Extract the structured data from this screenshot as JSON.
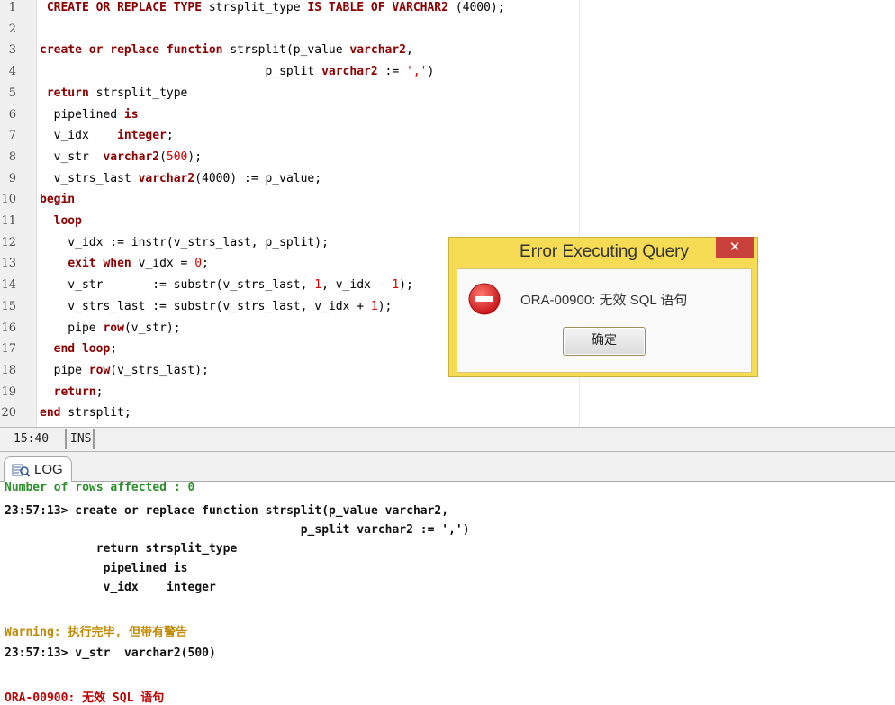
{
  "editor": {
    "line_numbers": [
      "1",
      "2",
      "3",
      "4",
      "5",
      "6",
      "7",
      "8",
      "9",
      "10",
      "11",
      "12",
      "13",
      "14",
      "15",
      "16",
      "17",
      "18",
      "19",
      "20"
    ],
    "lines": [
      [
        {
          "t": " ",
          "c": ""
        },
        {
          "t": "CREATE OR REPLACE TYPE",
          "c": "kw"
        },
        {
          "t": " strsplit_type ",
          "c": ""
        },
        {
          "t": "IS TABLE OF VARCHAR2",
          "c": "kw"
        },
        {
          "t": " (4000);",
          "c": ""
        }
      ],
      [],
      [
        {
          "t": "create or replace function",
          "c": "kw"
        },
        {
          "t": " strsplit(p_value ",
          "c": ""
        },
        {
          "t": "varchar2",
          "c": "kw"
        },
        {
          "t": ",",
          "c": ""
        }
      ],
      [
        {
          "t": "                                p_split ",
          "c": ""
        },
        {
          "t": "varchar2",
          "c": "kw"
        },
        {
          "t": " := ",
          "c": ""
        },
        {
          "t": "','",
          "c": "str"
        },
        {
          "t": ")",
          "c": ""
        }
      ],
      [
        {
          "t": " return",
          "c": "kw"
        },
        {
          "t": " strsplit_type",
          "c": ""
        }
      ],
      [
        {
          "t": "  pipelined ",
          "c": ""
        },
        {
          "t": "is",
          "c": "kw"
        }
      ],
      [
        {
          "t": "  v_idx    ",
          "c": ""
        },
        {
          "t": "integer",
          "c": "kw"
        },
        {
          "t": ";",
          "c": ""
        }
      ],
      [
        {
          "t": "  v_str  ",
          "c": ""
        },
        {
          "t": "varchar2",
          "c": "kw"
        },
        {
          "t": "(",
          "c": ""
        },
        {
          "t": "500",
          "c": "num"
        },
        {
          "t": ");",
          "c": ""
        }
      ],
      [
        {
          "t": "  v_strs_last ",
          "c": ""
        },
        {
          "t": "varchar2",
          "c": "kw"
        },
        {
          "t": "(4000) := p_value;",
          "c": ""
        }
      ],
      [
        {
          "t": "begin",
          "c": "kw"
        }
      ],
      [
        {
          "t": "  loop",
          "c": "kw"
        }
      ],
      [
        {
          "t": "    v_idx := instr(v_strs_last, p_split);",
          "c": ""
        }
      ],
      [
        {
          "t": "    ",
          "c": ""
        },
        {
          "t": "exit when",
          "c": "kw"
        },
        {
          "t": " v_idx = ",
          "c": ""
        },
        {
          "t": "0",
          "c": "num"
        },
        {
          "t": ";",
          "c": ""
        }
      ],
      [
        {
          "t": "    v_str       := substr(v_strs_last, ",
          "c": ""
        },
        {
          "t": "1",
          "c": "num"
        },
        {
          "t": ", v_idx - ",
          "c": ""
        },
        {
          "t": "1",
          "c": "num"
        },
        {
          "t": ");",
          "c": ""
        }
      ],
      [
        {
          "t": "    v_strs_last := substr(v_strs_last, v_idx + ",
          "c": ""
        },
        {
          "t": "1",
          "c": "num"
        },
        {
          "t": ");",
          "c": ""
        }
      ],
      [
        {
          "t": "    pipe ",
          "c": ""
        },
        {
          "t": "row",
          "c": "kw"
        },
        {
          "t": "(v_str);",
          "c": ""
        }
      ],
      [
        {
          "t": "  end loop",
          "c": "kw"
        },
        {
          "t": ";",
          "c": ""
        }
      ],
      [
        {
          "t": "  pipe ",
          "c": ""
        },
        {
          "t": "row",
          "c": "kw"
        },
        {
          "t": "(v_strs_last);",
          "c": ""
        }
      ],
      [
        {
          "t": "  return",
          "c": "kw"
        },
        {
          "t": ";",
          "c": ""
        }
      ],
      [
        {
          "t": "end",
          "c": "kw"
        },
        {
          "t": " strsplit;",
          "c": ""
        }
      ]
    ]
  },
  "statusbar": {
    "position": "15:40",
    "mode": "INS"
  },
  "log": {
    "tab_label": "LOG",
    "lines": [
      {
        "text": "Number of rows affected : 0",
        "cls": "g"
      },
      {
        "text": "23:57:13> create or replace function strsplit(p_value varchar2,",
        "cls": "b"
      },
      {
        "text": "                                          p_split varchar2 := ',')",
        "cls": "b"
      },
      {
        "text": "             return strsplit_type",
        "cls": "b"
      },
      {
        "text": "              pipelined is",
        "cls": "b"
      },
      {
        "text": "              v_idx    integer",
        "cls": "b"
      },
      {
        "text": "Warning: 执行完毕, 但带有警告",
        "cls": "w"
      },
      {
        "text": "23:57:13> v_str  varchar2(500)",
        "cls": "b"
      },
      {
        "text": "ORA-00900: 无效 SQL 语句",
        "cls": "r"
      }
    ]
  },
  "dialog": {
    "title": "Error Executing Query",
    "close": "✕",
    "message": "ORA-00900: 无效 SQL 语句",
    "ok_label": "确定",
    "icon": "error-icon"
  }
}
